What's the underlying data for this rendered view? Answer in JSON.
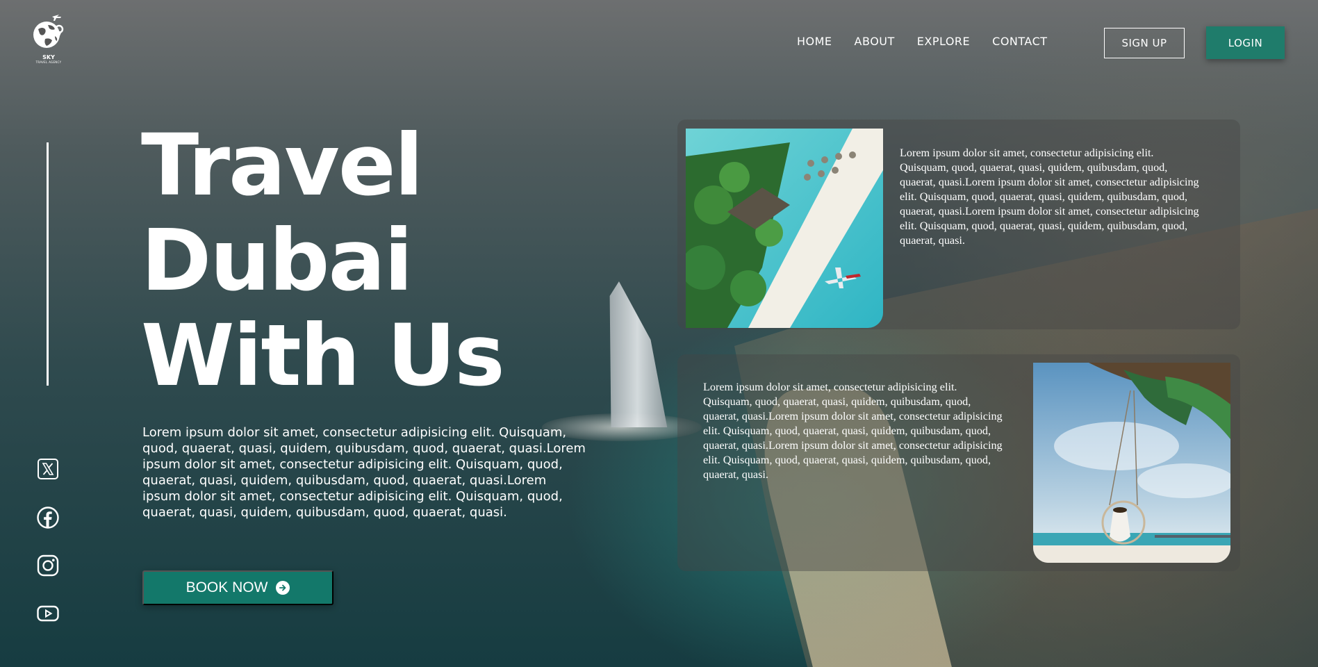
{
  "brand": {
    "name": "SKY",
    "tagline": "TRAVEL AGENCY"
  },
  "nav": {
    "items": [
      "HOME",
      "ABOUT",
      "EXPLORE",
      "CONTACT"
    ]
  },
  "auth": {
    "signup_label": "SIGN UP",
    "login_label": "LOGIN"
  },
  "hero": {
    "title_lines": [
      "Travel",
      "Dubai",
      "With Us"
    ],
    "description": "Lorem ipsum dolor sit amet, consectetur adipisicing elit. Quisquam, quod, quaerat, quasi, quidem, quibusdam, quod, quaerat, quasi.Lorem ipsum dolor sit amet, consectetur adipisicing elit. Quisquam, quod, quaerat, quasi, quidem, quibusdam, quod, quaerat, quasi.Lorem ipsum dolor sit amet, consectetur adipisicing elit. Quisquam, quod, quaerat, quasi, quidem, quibusdam, quod, quaerat, quasi.",
    "cta_label": "BOOK NOW"
  },
  "social": [
    "x-icon",
    "facebook-icon",
    "instagram-icon",
    "youtube-icon"
  ],
  "cards": [
    {
      "image": "maldives-beach-seaplane",
      "text": "Lorem ipsum dolor sit amet, consectetur adipisicing elit. Quisquam, quod, quaerat, quasi, quidem, quibusdam, quod, quaerat, quasi.Lorem ipsum dolor sit amet, consectetur adipisicing elit. Quisquam, quod, quaerat, quasi, quidem, quibusdam, quod, quaerat, quasi.Lorem ipsum dolor sit amet, consectetur adipisicing elit. Quisquam, quod, quaerat, quasi, quidem, quibusdam, quod, quaerat, quasi."
    },
    {
      "image": "palm-swing-beach",
      "text": "Lorem ipsum dolor sit amet, consectetur adipisicing elit. Quisquam, quod, quaerat, quasi, quidem, quibusdam, quod, quaerat, quasi.Lorem ipsum dolor sit amet, consectetur adipisicing elit. Quisquam, quod, quaerat, quasi, quidem, quibusdam, quod, quaerat, quasi.Lorem ipsum dolor sit amet, consectetur adipisicing elit. Quisquam, quod, quaerat, quasi, quidem, quibusdam, quod, quaerat, quasi."
    }
  ],
  "colors": {
    "accent": "#1f7c6b",
    "cta": "#13786a"
  }
}
